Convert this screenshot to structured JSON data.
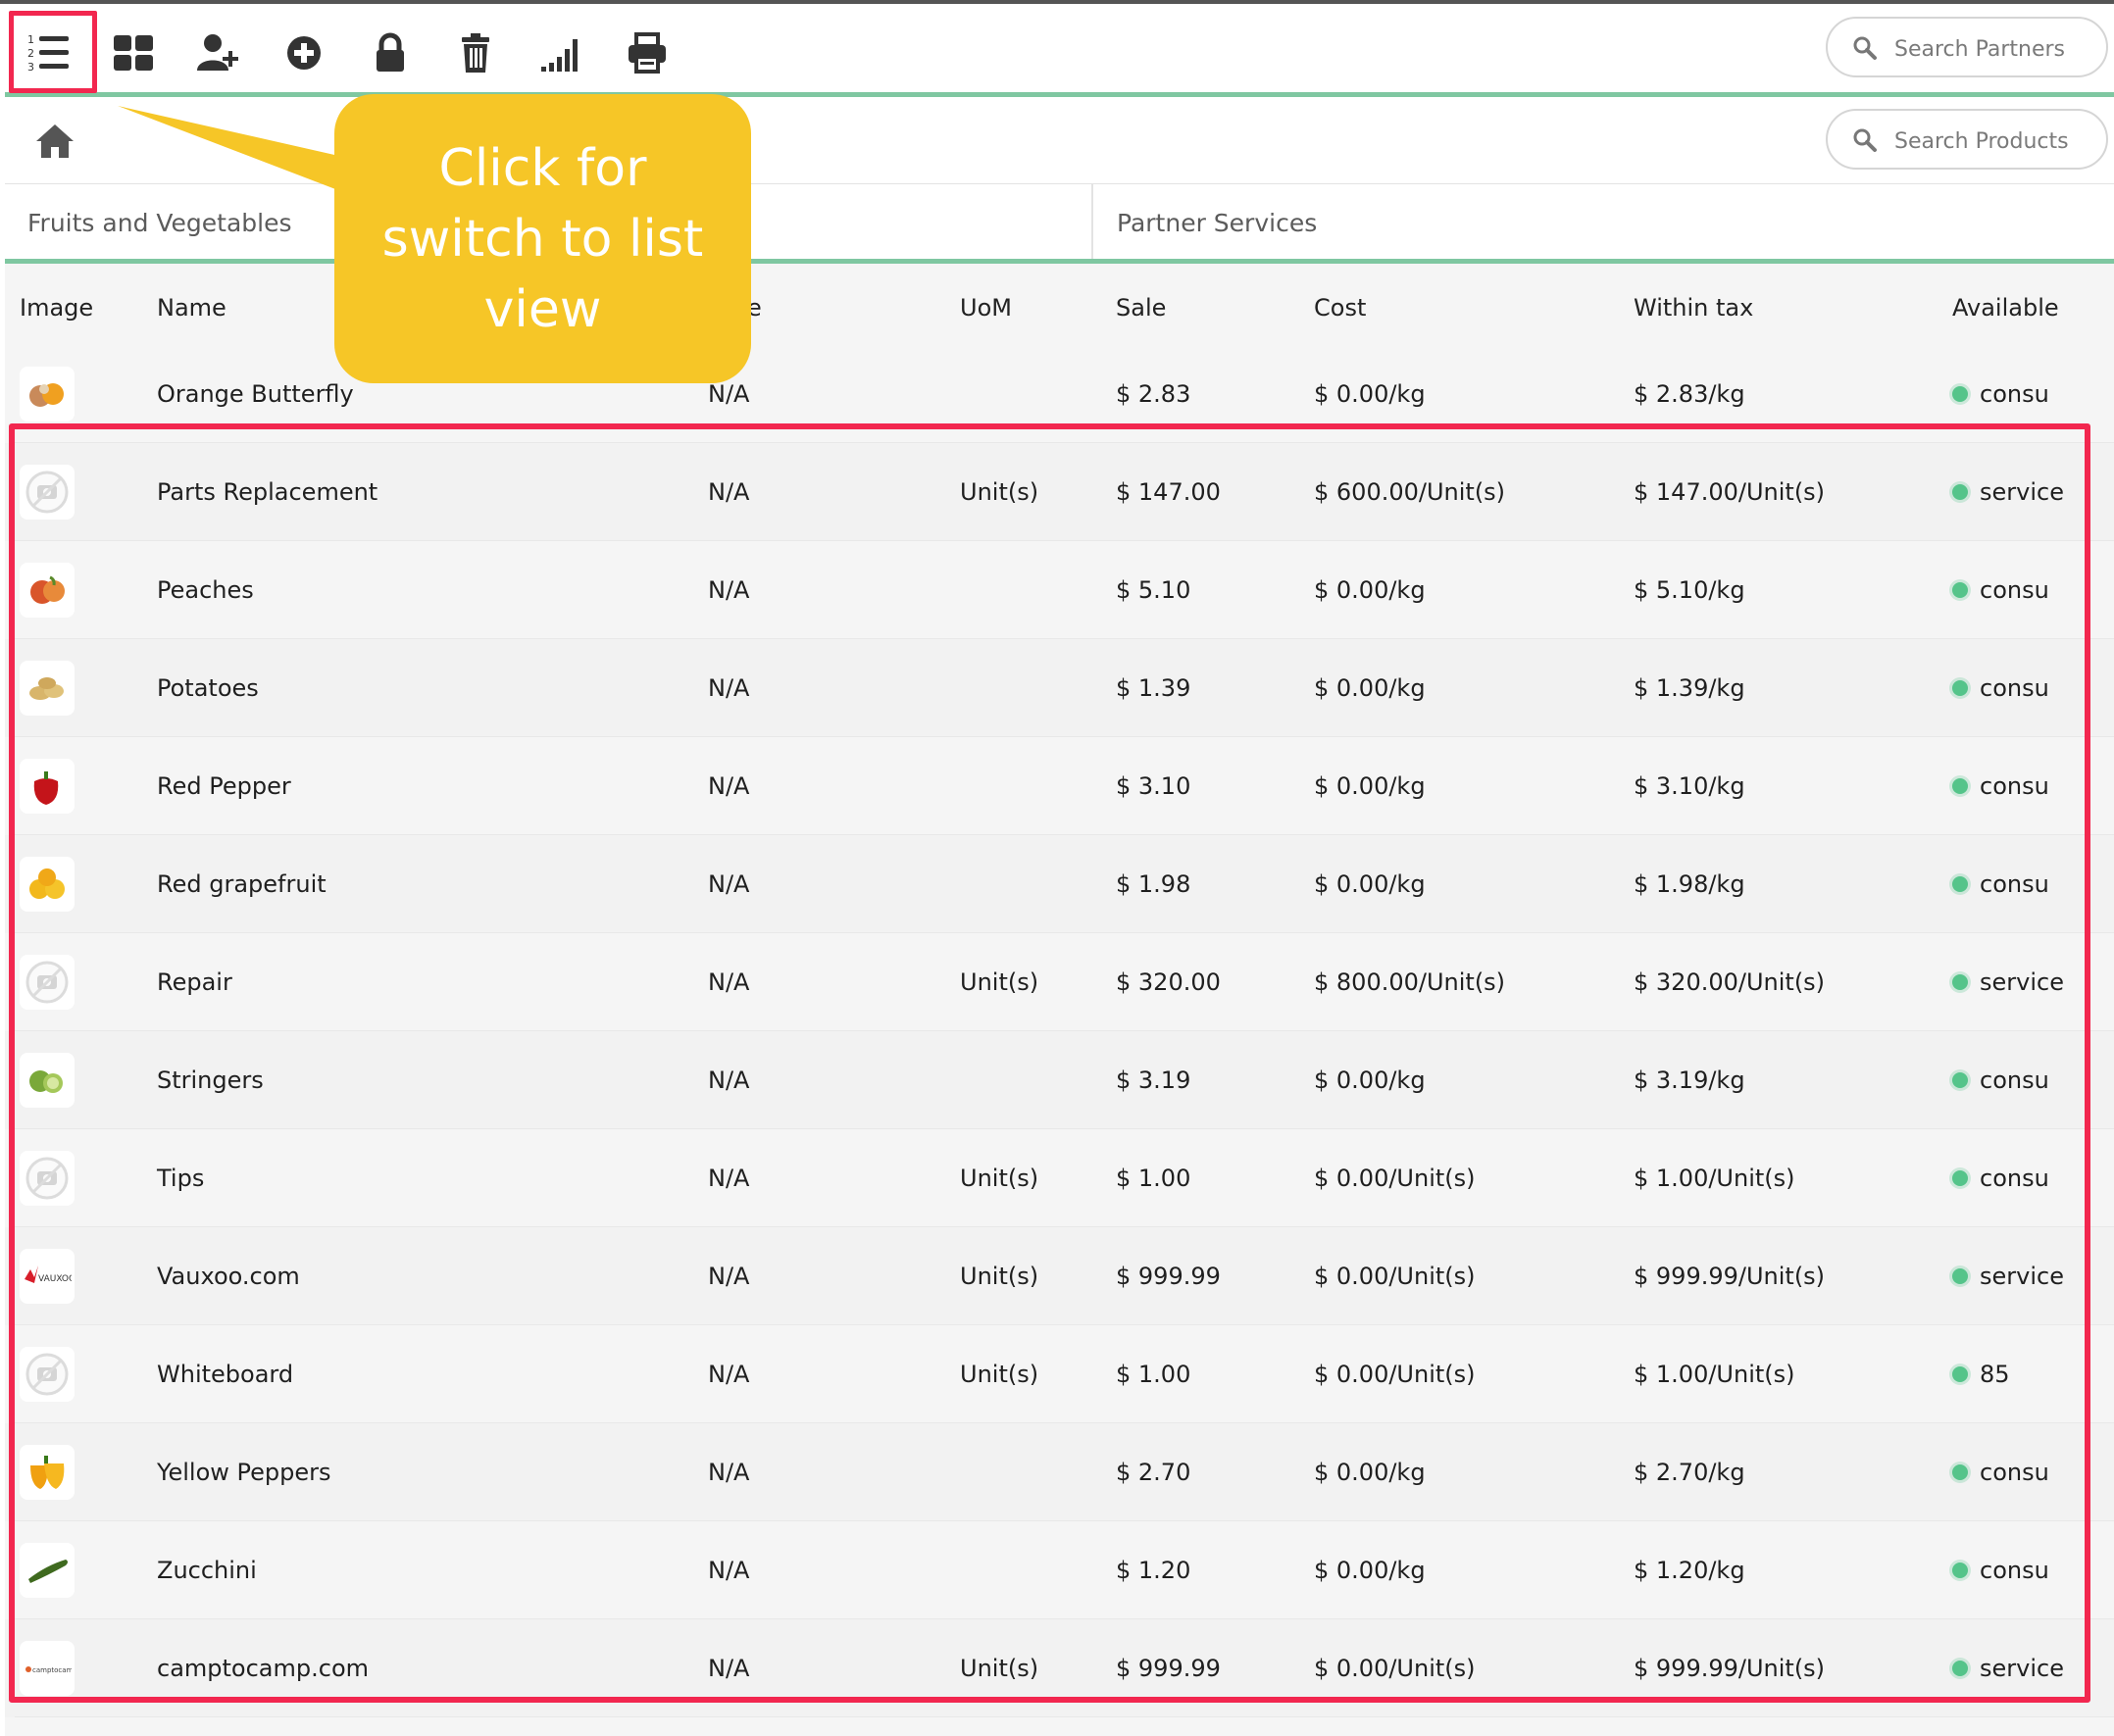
{
  "toolbar": {
    "search_partners_placeholder": "Search Partners",
    "buttons": [
      "list-view-icon",
      "grid-view-icon",
      "add-user-icon",
      "add-circle-icon",
      "lock-icon",
      "trash-icon",
      "signal-icon",
      "printer-icon"
    ]
  },
  "breadcrumb": {
    "search_products_placeholder": "Search Products"
  },
  "categories": {
    "left": "Fruits and Vegetables",
    "right": "Partner Services"
  },
  "table": {
    "headers": {
      "image": "Image",
      "name": "Name",
      "code": "e",
      "uom": "UoM",
      "sale": "Sale",
      "cost": "Cost",
      "within_tax": "Within tax",
      "available": "Available"
    },
    "rows": [
      {
        "name": "Orange Butterfly",
        "code": "N/A",
        "uom": "",
        "sale": "$ 2.83",
        "cost": "$ 0.00/kg",
        "within_tax": "$ 2.83/kg",
        "available": "consu",
        "image": "orange"
      },
      {
        "name": "Parts Replacement",
        "code": "N/A",
        "uom": "Unit(s)",
        "sale": "$ 147.00",
        "cost": "$ 600.00/Unit(s)",
        "within_tax": "$ 147.00/Unit(s)",
        "available": "service",
        "image": "placeholder"
      },
      {
        "name": "Peaches",
        "code": "N/A",
        "uom": "",
        "sale": "$ 5.10",
        "cost": "$ 0.00/kg",
        "within_tax": "$ 5.10/kg",
        "available": "consu",
        "image": "peach"
      },
      {
        "name": "Potatoes",
        "code": "N/A",
        "uom": "",
        "sale": "$ 1.39",
        "cost": "$ 0.00/kg",
        "within_tax": "$ 1.39/kg",
        "available": "consu",
        "image": "potato"
      },
      {
        "name": "Red Pepper",
        "code": "N/A",
        "uom": "",
        "sale": "$ 3.10",
        "cost": "$ 0.00/kg",
        "within_tax": "$ 3.10/kg",
        "available": "consu",
        "image": "red-pepper"
      },
      {
        "name": "Red grapefruit",
        "code": "N/A",
        "uom": "",
        "sale": "$ 1.98",
        "cost": "$ 0.00/kg",
        "within_tax": "$ 1.98/kg",
        "available": "consu",
        "image": "grapefruit"
      },
      {
        "name": "Repair",
        "code": "N/A",
        "uom": "Unit(s)",
        "sale": "$ 320.00",
        "cost": "$ 800.00/Unit(s)",
        "within_tax": "$ 320.00/Unit(s)",
        "available": "service",
        "image": "placeholder"
      },
      {
        "name": "Stringers",
        "code": "N/A",
        "uom": "",
        "sale": "$ 3.19",
        "cost": "$ 0.00/kg",
        "within_tax": "$ 3.19/kg",
        "available": "consu",
        "image": "lime"
      },
      {
        "name": "Tips",
        "code": "N/A",
        "uom": "Unit(s)",
        "sale": "$ 1.00",
        "cost": "$ 0.00/Unit(s)",
        "within_tax": "$ 1.00/Unit(s)",
        "available": "consu",
        "image": "placeholder"
      },
      {
        "name": "Vauxoo.com",
        "code": "N/A",
        "uom": "Unit(s)",
        "sale": "$ 999.99",
        "cost": "$ 0.00/Unit(s)",
        "within_tax": "$ 999.99/Unit(s)",
        "available": "service",
        "image": "vauxoo-logo",
        "logo_text": "VAUXOO"
      },
      {
        "name": "Whiteboard",
        "code": "N/A",
        "uom": "Unit(s)",
        "sale": "$ 1.00",
        "cost": "$ 0.00/Unit(s)",
        "within_tax": "$ 1.00/Unit(s)",
        "available": "85",
        "image": "placeholder"
      },
      {
        "name": "Yellow Peppers",
        "code": "N/A",
        "uom": "",
        "sale": "$ 2.70",
        "cost": "$ 0.00/kg",
        "within_tax": "$ 2.70/kg",
        "available": "consu",
        "image": "yellow-pepper"
      },
      {
        "name": "Zucchini",
        "code": "N/A",
        "uom": "",
        "sale": "$ 1.20",
        "cost": "$ 0.00/kg",
        "within_tax": "$ 1.20/kg",
        "available": "consu",
        "image": "zucchini"
      },
      {
        "name": "camptocamp.com",
        "code": "N/A",
        "uom": "Unit(s)",
        "sale": "$ 999.99",
        "cost": "$ 0.00/Unit(s)",
        "within_tax": "$ 999.99/Unit(s)",
        "available": "service",
        "image": "camptocamp-logo",
        "logo_text": "camptocamp"
      }
    ]
  },
  "annotation": {
    "callout_text": "Click for switch to list view"
  },
  "colors": {
    "accent_green": "#7fc7a1",
    "available_dot": "#55c48a",
    "highlight_red": "#f2274f",
    "callout_yellow": "#f6c627"
  }
}
